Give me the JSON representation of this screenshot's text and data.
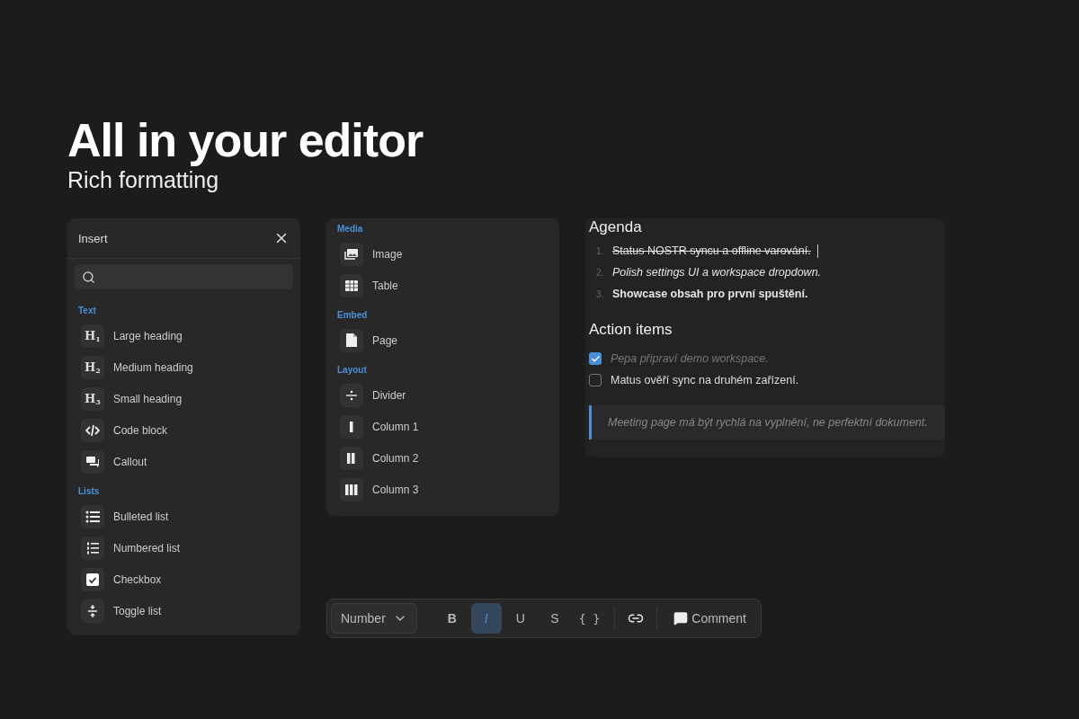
{
  "hero": {
    "title": "All in your editor",
    "subtitle": "Rich formatting"
  },
  "insert_panel": {
    "title": "Insert",
    "sections": [
      {
        "label": "Text",
        "items": [
          {
            "kind": "heading",
            "glyph": "H$_{1}$",
            "label": "Large heading"
          },
          {
            "kind": "heading",
            "glyph": "H$_{2}$",
            "label": "Medium heading"
          },
          {
            "kind": "heading",
            "glyph": "H$_{3}$",
            "label": "Small heading"
          },
          {
            "kind": "code",
            "label": "Code block"
          },
          {
            "kind": "callout",
            "label": "Callout"
          }
        ]
      },
      {
        "label": "Lists",
        "items": [
          {
            "kind": "bulleted",
            "label": "Bulleted list"
          },
          {
            "kind": "numbered",
            "label": "Numbered list"
          },
          {
            "kind": "checkbox",
            "label": "Checkbox"
          },
          {
            "kind": "toggle",
            "label": "Toggle list"
          }
        ]
      }
    ]
  },
  "blocks_panel": {
    "sections": [
      {
        "label": "Media",
        "items": [
          {
            "kind": "image",
            "label": "Image"
          },
          {
            "kind": "table",
            "label": "Table"
          }
        ]
      },
      {
        "label": "Embed",
        "items": [
          {
            "kind": "page",
            "label": "Page"
          }
        ]
      },
      {
        "label": "Layout",
        "items": [
          {
            "kind": "divider",
            "label": "Divider"
          },
          {
            "kind": "column1",
            "label": "Column 1"
          },
          {
            "kind": "column2",
            "label": "Column 2"
          },
          {
            "kind": "column3",
            "label": "Column 3"
          }
        ]
      }
    ]
  },
  "document": {
    "agenda_heading": "Agenda",
    "agenda": [
      {
        "number": "1.",
        "text": "Status NOSTR syncu a offline varování.",
        "kind": "strike",
        "cursor": true
      },
      {
        "number": "2.",
        "text": "Polish settings UI a workspace dropdown.",
        "kind": "italic",
        "cursor": false
      },
      {
        "number": "3.",
        "text": "Showcase obsah pro první spuštění.",
        "kind": "bold",
        "cursor": false
      }
    ],
    "actions_heading": "Action items",
    "actions": [
      {
        "text": "Pepa připraví demo workspace.",
        "checked": true
      },
      {
        "text": "Matus ověří sync na druhém zařízení.",
        "checked": false
      }
    ],
    "quote": "Meeting page má být rychlá na vyplnění, ne perfektní dokument."
  },
  "toolbar": {
    "dropdown": "Number",
    "formats": [
      {
        "kind": "bold",
        "label": "B",
        "selected": false
      },
      {
        "kind": "italic",
        "label": "I",
        "selected": true
      },
      {
        "kind": "underline",
        "label": "U",
        "selected": false
      },
      {
        "kind": "strike",
        "label": "S",
        "selected": false
      },
      {
        "kind": "code",
        "label": "{ }",
        "selected": false
      }
    ],
    "comment": "Comment"
  }
}
